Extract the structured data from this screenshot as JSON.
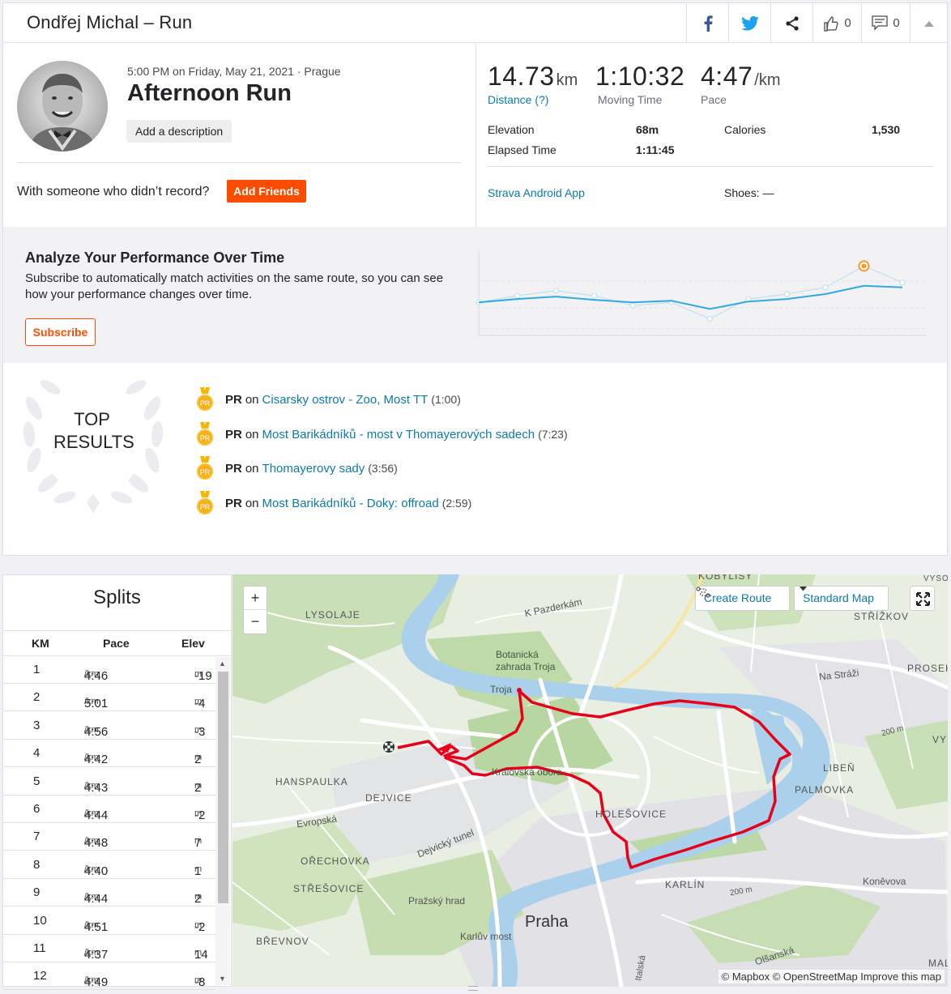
{
  "header": {
    "title": "Ondřej Michal – Run",
    "kudos_count": "0",
    "comments_count": "0"
  },
  "activity": {
    "meta": "5:00 PM on Friday, May 21, 2021 · Prague",
    "name": "Afternoon Run",
    "description_button": "Add a description",
    "with_someone": "With someone who didn’t record?",
    "add_friends": "Add Friends"
  },
  "stats": {
    "distance": {
      "value": "14.73",
      "unit": "km",
      "label": "Distance (?)"
    },
    "moving_time": {
      "value": "1:10:32",
      "label": "Moving Time"
    },
    "pace": {
      "value": "4:47",
      "unit": "/km",
      "label": "Pace"
    },
    "elevation": {
      "label": "Elevation",
      "value": "68m"
    },
    "elapsed": {
      "label": "Elapsed Time",
      "value": "1:11:45"
    },
    "calories": {
      "label": "Calories",
      "value": "1,530"
    },
    "device": "Strava Android App",
    "shoes": "Shoes: —"
  },
  "analyze": {
    "title": "Analyze Your Performance Over Time",
    "text": "Subscribe to automatically match activities on the same route, so you can see how your performance changes over time.",
    "subscribe": "Subscribe",
    "chart_data": {
      "type": "line",
      "series": [
        {
          "values": [
            4.0,
            4.2,
            4.35,
            4.15,
            4.0,
            4.1,
            3.6,
            4.05,
            4.2,
            4.5,
            5.0,
            4.9
          ]
        },
        {
          "values": [
            4.0,
            4.4,
            4.7,
            4.4,
            3.8,
            4.0,
            3.0,
            4.2,
            4.5,
            4.9,
            6.2,
            5.2
          ]
        }
      ],
      "highlight_index": 10,
      "grid": true,
      "colors": {
        "line": "#30a9e4",
        "faint": "#b9dcf0",
        "highlight": "#fc9a29"
      }
    }
  },
  "top_results": {
    "badge_line1": "TOP",
    "badge_line2": "RESULTS",
    "items": [
      {
        "pr": "PR",
        "on": "on",
        "segment": "Cisarsky ostrov - Zoo, Most TT",
        "time": "(1:00)"
      },
      {
        "pr": "PR",
        "on": "on",
        "segment": "Most Barikádníků - most v Thomayerových sadech",
        "time": "(7:23)"
      },
      {
        "pr": "PR",
        "on": "on",
        "segment": "Thomayerovy sady",
        "time": "(3:56)"
      },
      {
        "pr": "PR",
        "on": "on",
        "segment": "Most Barikádníků - Doky: offroad",
        "time": "(2:59)"
      }
    ],
    "medal_label": "PR"
  },
  "splits": {
    "title": "Splits",
    "headers": {
      "km": "KM",
      "pace": "Pace",
      "elev": "Elev"
    },
    "pace_unit": "/km",
    "elev_unit": "m",
    "rows": [
      {
        "km": "1",
        "pace": "4:46",
        "elev": "-19"
      },
      {
        "km": "2",
        "pace": "5:01",
        "elev": "-4"
      },
      {
        "km": "3",
        "pace": "4:56",
        "elev": "-3"
      },
      {
        "km": "4",
        "pace": "4:42",
        "elev": "2"
      },
      {
        "km": "5",
        "pace": "4:43",
        "elev": "2"
      },
      {
        "km": "6",
        "pace": "4:44",
        "elev": "-2"
      },
      {
        "km": "7",
        "pace": "4:48",
        "elev": "7"
      },
      {
        "km": "8",
        "pace": "4:40",
        "elev": "1"
      },
      {
        "km": "9",
        "pace": "4:44",
        "elev": "2"
      },
      {
        "km": "10",
        "pace": "4:51",
        "elev": "-2"
      },
      {
        "km": "11",
        "pace": "4:37",
        "elev": "14"
      },
      {
        "km": "12",
        "pace": "4:49",
        "elev": "-8"
      }
    ]
  },
  "map": {
    "zoom_in": "+",
    "zoom_out": "−",
    "create_route": "Create Route",
    "map_style": "Standard Map",
    "attribution": "© Mapbox © OpenStreetMap Improve this map",
    "labels": {
      "lysolaje": "LYSOLAJE",
      "pazderkam": "K Pazderkám",
      "strizkov": "STŘÍŽKOV",
      "botanicka": "Botanická\nzahrada Troja",
      "troja": "Troja",
      "na_strazi": "Na Stráži",
      "prosek": "PROSEK",
      "hanspaulka": "HANSPAULKA",
      "kralovska": "Královská obora",
      "liben": "LIBEŇ",
      "palmovka": "PALMOVKA",
      "dejvice": "DEJVICE",
      "holesovice": "HOLEŠOVICE",
      "evropska": "Evropská",
      "dejvicky": "Dejvický tunel",
      "orechovka": "OŘECHOVKA",
      "stresovice": "STŘEŠOVICE",
      "karlin": "KARLÍN",
      "konevova": "Koněvova",
      "prazsky_hrad": "Pražský hrad",
      "praha": "Praha",
      "brevnov": "BŘEVNOV",
      "karluv": "Karlův most",
      "olsanska": "Olšanská",
      "h200a": "200 m",
      "h200b": "200 m",
      "italska": "Italská",
      "vy": "VY",
      "kobylisy": "KOBYLISY",
      "vysocany": "VYSOČANY",
      "mal": "MAL"
    },
    "colors": {
      "route": "#e8001a",
      "river": "#a9cde8",
      "park": "#c6deb3",
      "road": "#ffffff"
    }
  }
}
